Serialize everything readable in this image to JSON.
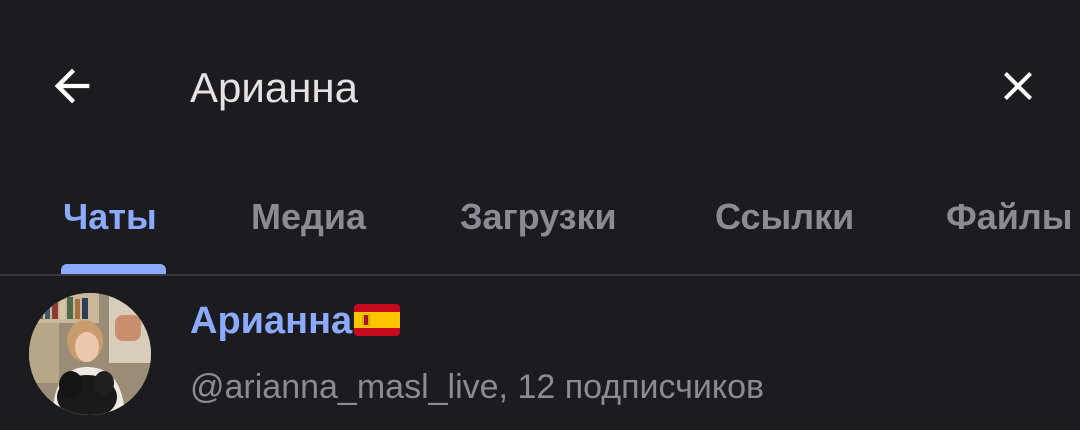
{
  "search": {
    "query": "Арианна"
  },
  "tabs": [
    {
      "label": "Чаты",
      "active": true
    },
    {
      "label": "Медиа",
      "active": false
    },
    {
      "label": "Загрузки",
      "active": false
    },
    {
      "label": "Ссылки",
      "active": false
    },
    {
      "label": "Файлы",
      "active": false
    }
  ],
  "results": [
    {
      "name": "Арианна",
      "flag_icon": "spain-flag-icon",
      "subtitle": "@arianna_masl_live, 12 подписчиков"
    }
  ],
  "colors": {
    "background": "#1c1b1f",
    "accent": "#8cabff",
    "text_primary": "#e6e1e5",
    "text_secondary": "#8e8a93"
  }
}
